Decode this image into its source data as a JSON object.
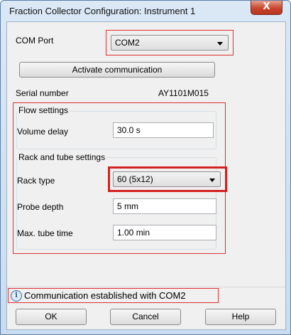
{
  "window": {
    "title": "Fraction Collector Configuration: Instrument 1",
    "close_label": "X"
  },
  "com": {
    "label": "COM Port",
    "selected": "COM2",
    "activate_label": "Activate communication"
  },
  "serial": {
    "label": "Serial number",
    "value": "AY1101M015"
  },
  "flow": {
    "group_title": "Flow settings",
    "volume_delay_label": "Volume delay",
    "volume_delay_value": "30.0 s"
  },
  "rack": {
    "group_title": "Rack and tube settings",
    "rack_type_label": "Rack type",
    "rack_type_selected": "60 (5x12)",
    "probe_depth_label": "Probe depth",
    "probe_depth_value": "5 mm",
    "max_tube_time_label": "Max. tube time",
    "max_tube_time_value": "1.00 min"
  },
  "status": {
    "icon": "info-icon",
    "text": "Communication established with COM2"
  },
  "buttons": {
    "ok": "OK",
    "cancel": "Cancel",
    "help": "Help"
  },
  "colors": {
    "highlight": "#e03030",
    "title_bar": "#c9dcf0",
    "close_button": "#c8462c"
  }
}
